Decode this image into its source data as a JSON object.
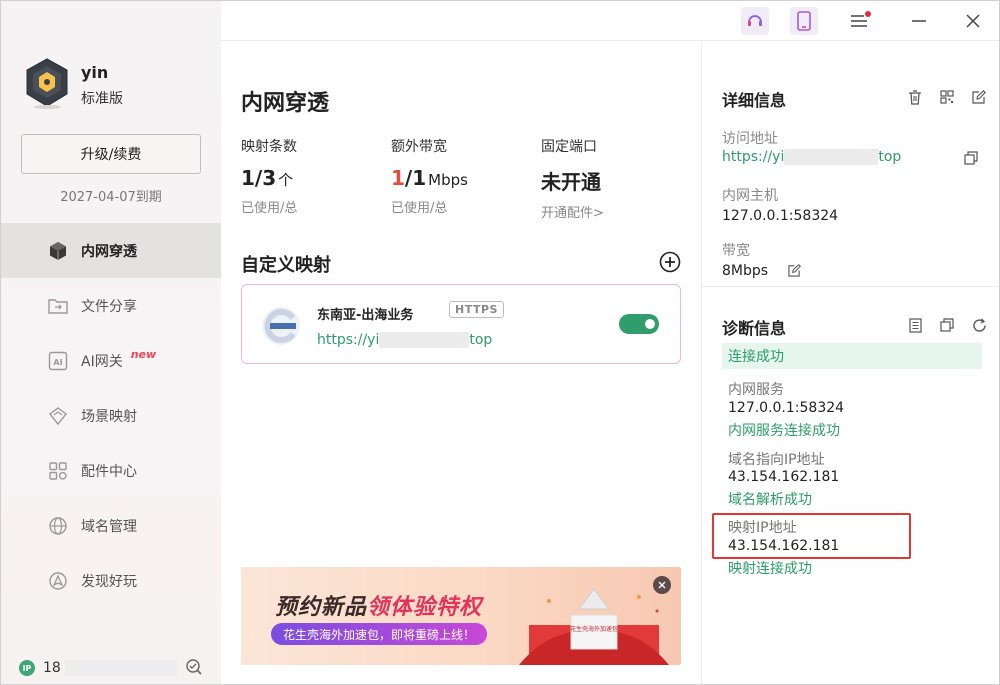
{
  "profile": {
    "name": "yin",
    "tier": "标准版",
    "upgrade_label": "升级/续费",
    "expire": "2027-04-07到期"
  },
  "nav": [
    {
      "label": "内网穿透",
      "icon": "cube-icon",
      "active": true
    },
    {
      "label": "文件分享",
      "icon": "folder-share-icon"
    },
    {
      "label": "AI网关",
      "icon": "ai-icon",
      "badge": "new"
    },
    {
      "label": "场景映射",
      "icon": "scene-icon"
    },
    {
      "label": "配件中心",
      "icon": "grid-icon"
    },
    {
      "label": "域名管理",
      "icon": "globe-icon"
    },
    {
      "label": "发现好玩",
      "icon": "discover-icon"
    }
  ],
  "ip": {
    "badge": "IP",
    "prefix": "18"
  },
  "main": {
    "title": "内网穿透",
    "stats": [
      {
        "label": "映射条数",
        "used": "1",
        "total": "/3",
        "unit": "个",
        "sub": "已使用/总"
      },
      {
        "label": "额外带宽",
        "used": "1",
        "total": "/1",
        "unit": "Mbps",
        "sub": "已使用/总"
      },
      {
        "label": "固定端口",
        "value": "未开通",
        "sub": "开通配件>"
      }
    ],
    "section_title": "自定义映射",
    "mapping": {
      "name": "东南亚-出海业务",
      "protocol": "HTTPS",
      "url_start": "https://yi",
      "url_end": "top",
      "enabled": true
    },
    "banner": {
      "title_a": "预约新品",
      "title_b": "领体验特权",
      "sub": "花生壳海外加速包，即将重磅上线！",
      "gift_text": "花生壳海外加速包"
    }
  },
  "detail": {
    "title": "详细信息",
    "access_label": "访问地址",
    "access_start": "https://yi",
    "access_end": "top",
    "host_label": "内网主机",
    "host_value": "127.0.0.1:58324",
    "bw_label": "带宽",
    "bw_value": "8Mbps"
  },
  "diagnosis": {
    "title": "诊断信息",
    "status": "连接成功",
    "items": [
      {
        "label": "内网服务",
        "value": "127.0.0.1:58324",
        "result": "内网服务连接成功"
      },
      {
        "label": "域名指向IP地址",
        "value": "43.154.162.181",
        "result": "域名解析成功"
      },
      {
        "label": "映射IP地址",
        "value": "43.154.162.181",
        "result": "映射连接成功"
      }
    ]
  },
  "colors": {
    "accent": "#2d9d6a",
    "highlight": "#e0392f",
    "new": "#e8445a"
  }
}
